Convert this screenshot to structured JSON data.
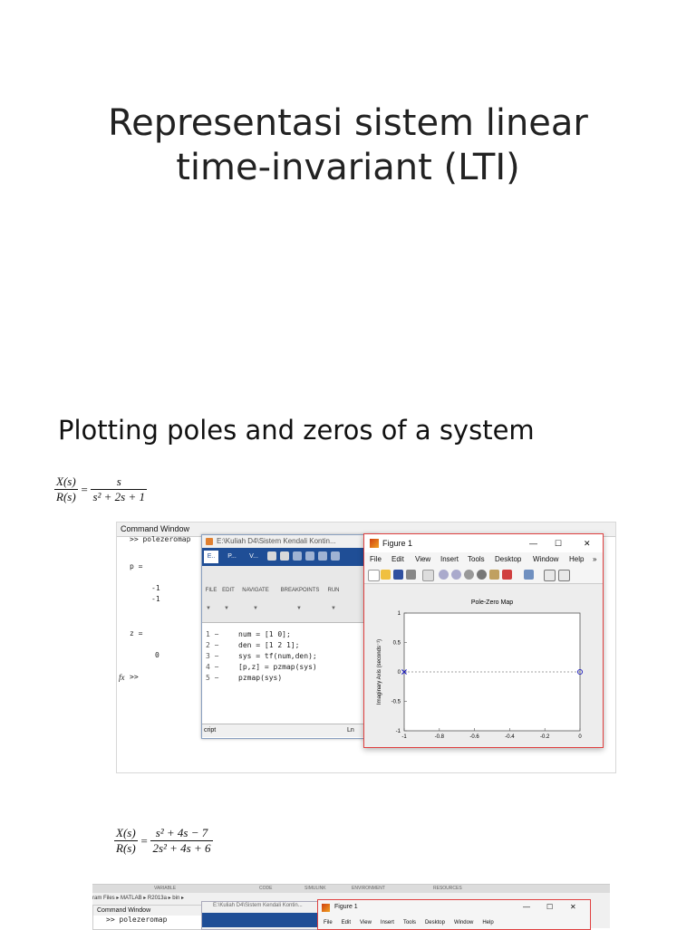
{
  "slide": {
    "title_line1": "Representasi sistem linear",
    "title_line2": "time-invariant (LTI)",
    "subtitle": "Plotting poles and zeros of a system"
  },
  "eq1": {
    "lhs_num": "X(s)",
    "lhs_den": "R(s)",
    "eq": "=",
    "rhs_num": "s",
    "rhs_den": "s² + 2s + 1"
  },
  "eq2": {
    "lhs_num": "X(s)",
    "lhs_den": "R(s)",
    "eq": "=",
    "rhs_num": "s² + 4s  − 7",
    "rhs_den": "2s² + 4s + 6"
  },
  "command_window": {
    "title": "Command Window",
    "prompt_cmd": ">> polezeromap",
    "p_label": "p =",
    "p_val1": "-1",
    "p_val2": "-1",
    "z_label": "z =",
    "z_val": "0",
    "fx": "fx",
    "prompt": ">>"
  },
  "editor": {
    "title": "E:\\Kuliah D4\\Sistem Kendali Kontin...",
    "tabs": [
      "E..",
      "P...",
      "V..."
    ],
    "ribbon": [
      "FILE",
      "EDIT",
      "NAVIGATE",
      "BREAKPOINTS",
      "RUN"
    ],
    "lines": [
      {
        "n": "1 −",
        "code": "num = [1 0];"
      },
      {
        "n": "2 −",
        "code": "den = [1 2 1];"
      },
      {
        "n": "3 −",
        "code": "sys = tf(num,den);"
      },
      {
        "n": "4 −",
        "code": "[p,z] = pzmap(sys)"
      },
      {
        "n": "5 −",
        "code": "pzmap(sys)"
      }
    ],
    "status_left": "cript",
    "status_right": "Ln"
  },
  "figure": {
    "title": "Figure 1",
    "menu": [
      "File",
      "Edit",
      "View",
      "Insert",
      "Tools",
      "Desktop",
      "Window",
      "Help"
    ],
    "overflow": "»",
    "window_controls": [
      "—",
      "☐",
      "✕"
    ]
  },
  "chart_data": {
    "type": "scatter",
    "title": "Pole-Zero Map",
    "ylabel": "Imaginary Axis (seconds⁻¹)",
    "xlabel": "",
    "xlim": [
      -1,
      0
    ],
    "ylim": [
      -1,
      1
    ],
    "x_ticks": [
      "-1",
      "-0.8",
      "-0.6",
      "-0.4",
      "-0.2",
      "0"
    ],
    "y_ticks": [
      "1",
      "0.5",
      "0",
      "-0.5",
      "-1"
    ],
    "poles": [
      [
        -1,
        0
      ],
      [
        -1,
        0
      ]
    ],
    "zeros": [
      [
        0,
        0
      ]
    ],
    "marker_color": "#2020c0"
  },
  "bottom_matlab": {
    "ribbon": [
      "VARIABLE",
      "CODE",
      "SIMULINK",
      "ENVIRONMENT",
      "RESOURCES"
    ],
    "path": "ram Files ▸ MATLAB ▸ R2013a ▸ bin ▸",
    "cw_title": "Command Window",
    "cmd": ">> polezeromap",
    "editor_title": "E:\\Kuliah D4\\Sistem Kendali Kontin...",
    "fig_title": "Figure 1",
    "menu": [
      "File",
      "Edit",
      "View",
      "Insert",
      "Tools",
      "Desktop",
      "Window",
      "Help"
    ],
    "window_controls": [
      "—",
      "☐",
      "✕"
    ]
  }
}
